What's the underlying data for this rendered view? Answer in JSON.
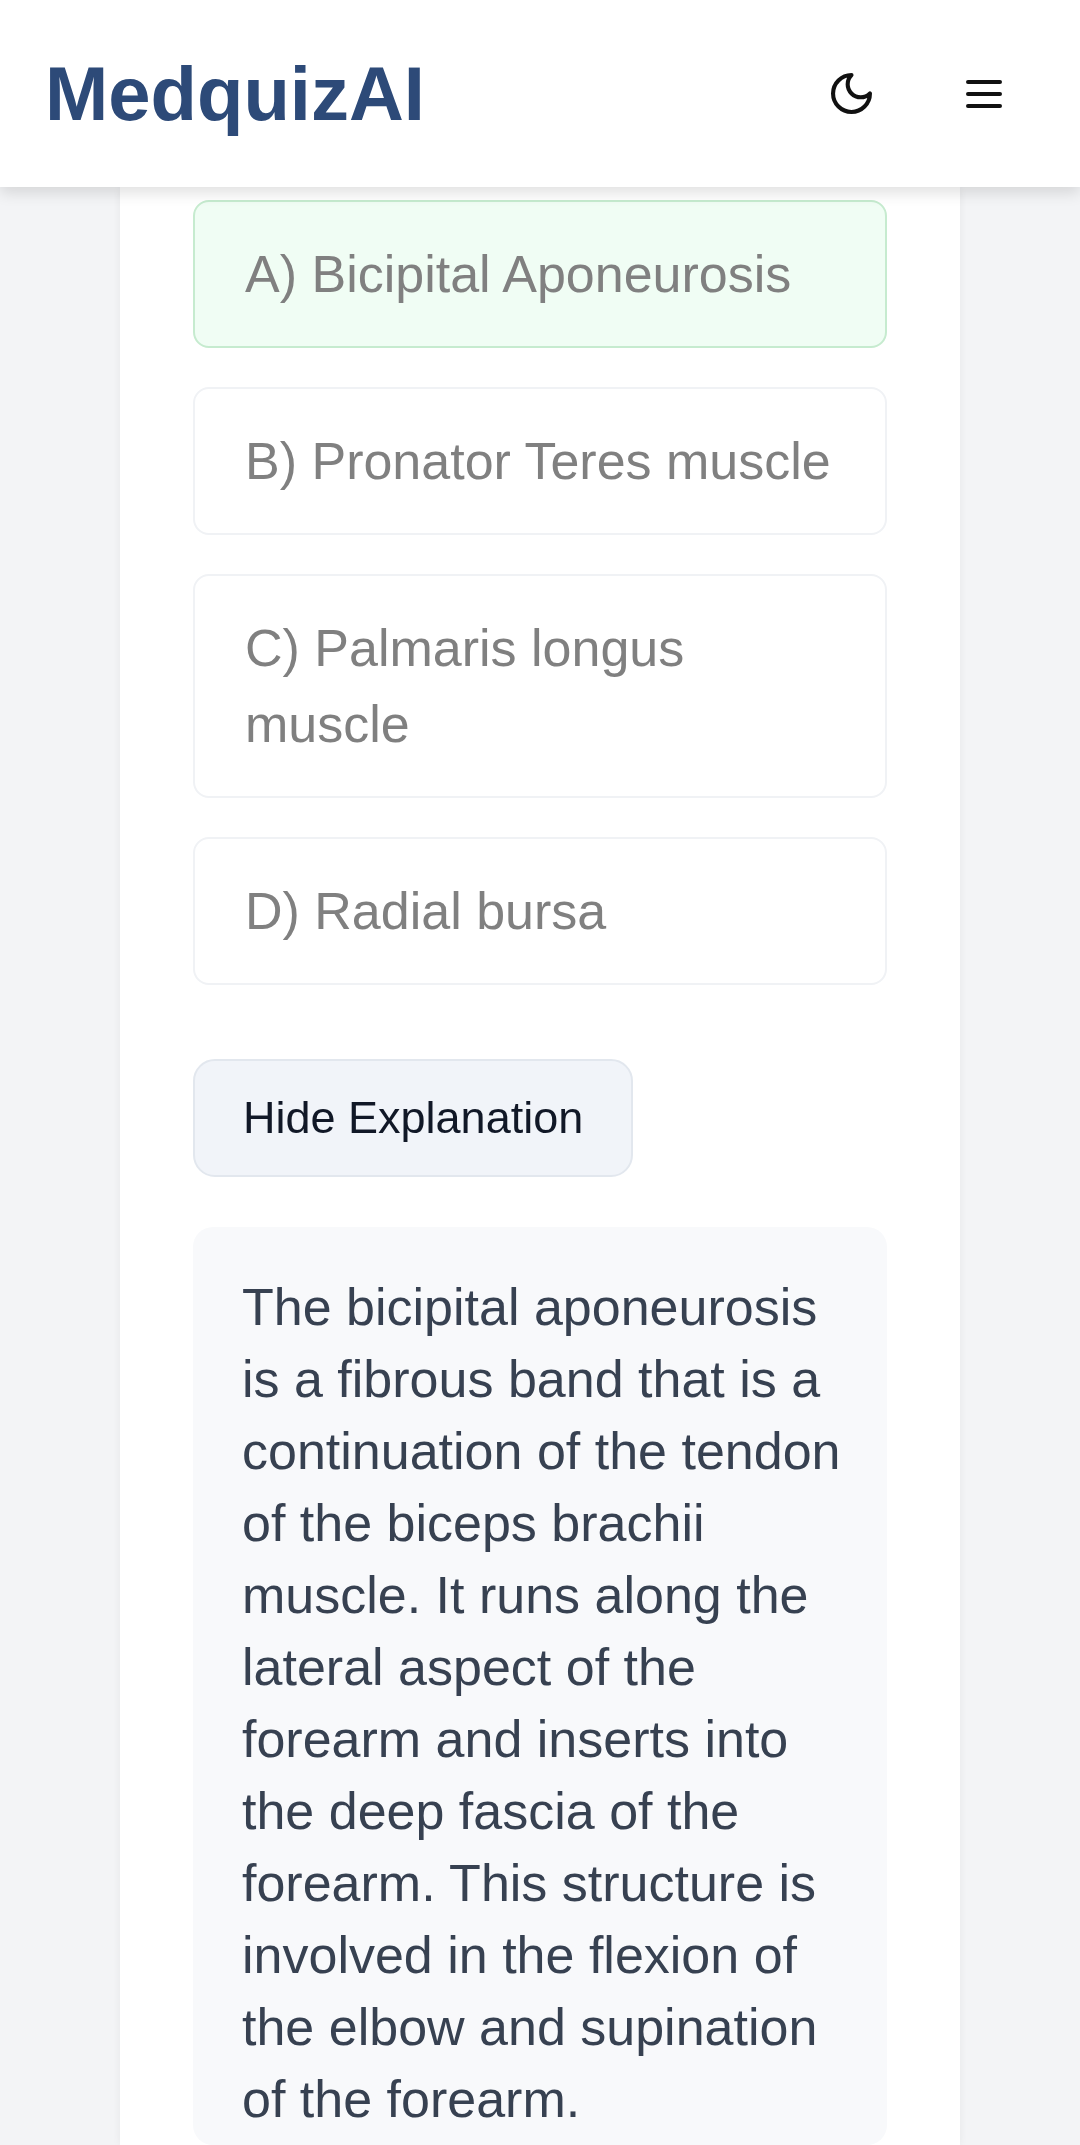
{
  "header": {
    "logo": "MedquizAI"
  },
  "options": [
    {
      "label": "A) Bicipital Aponeurosis",
      "correct": true,
      "disabled": true
    },
    {
      "label": "B) Pronator Teres muscle",
      "correct": false,
      "disabled": true
    },
    {
      "label": "C) Palmaris longus muscle",
      "correct": false,
      "disabled": true
    },
    {
      "label": "D) Radial bursa",
      "correct": false,
      "disabled": true
    }
  ],
  "explanation_button": {
    "label": "Hide Explanation"
  },
  "explanation": {
    "text": "The bicipital aponeurosis is a fibrous band that is a continuation of the tendon of the biceps brachii muscle. It runs along the lateral aspect of the forearm and inserts into the deep fascia of the forearm. This structure is involved in the flexion of the elbow and supination of the forearm."
  }
}
